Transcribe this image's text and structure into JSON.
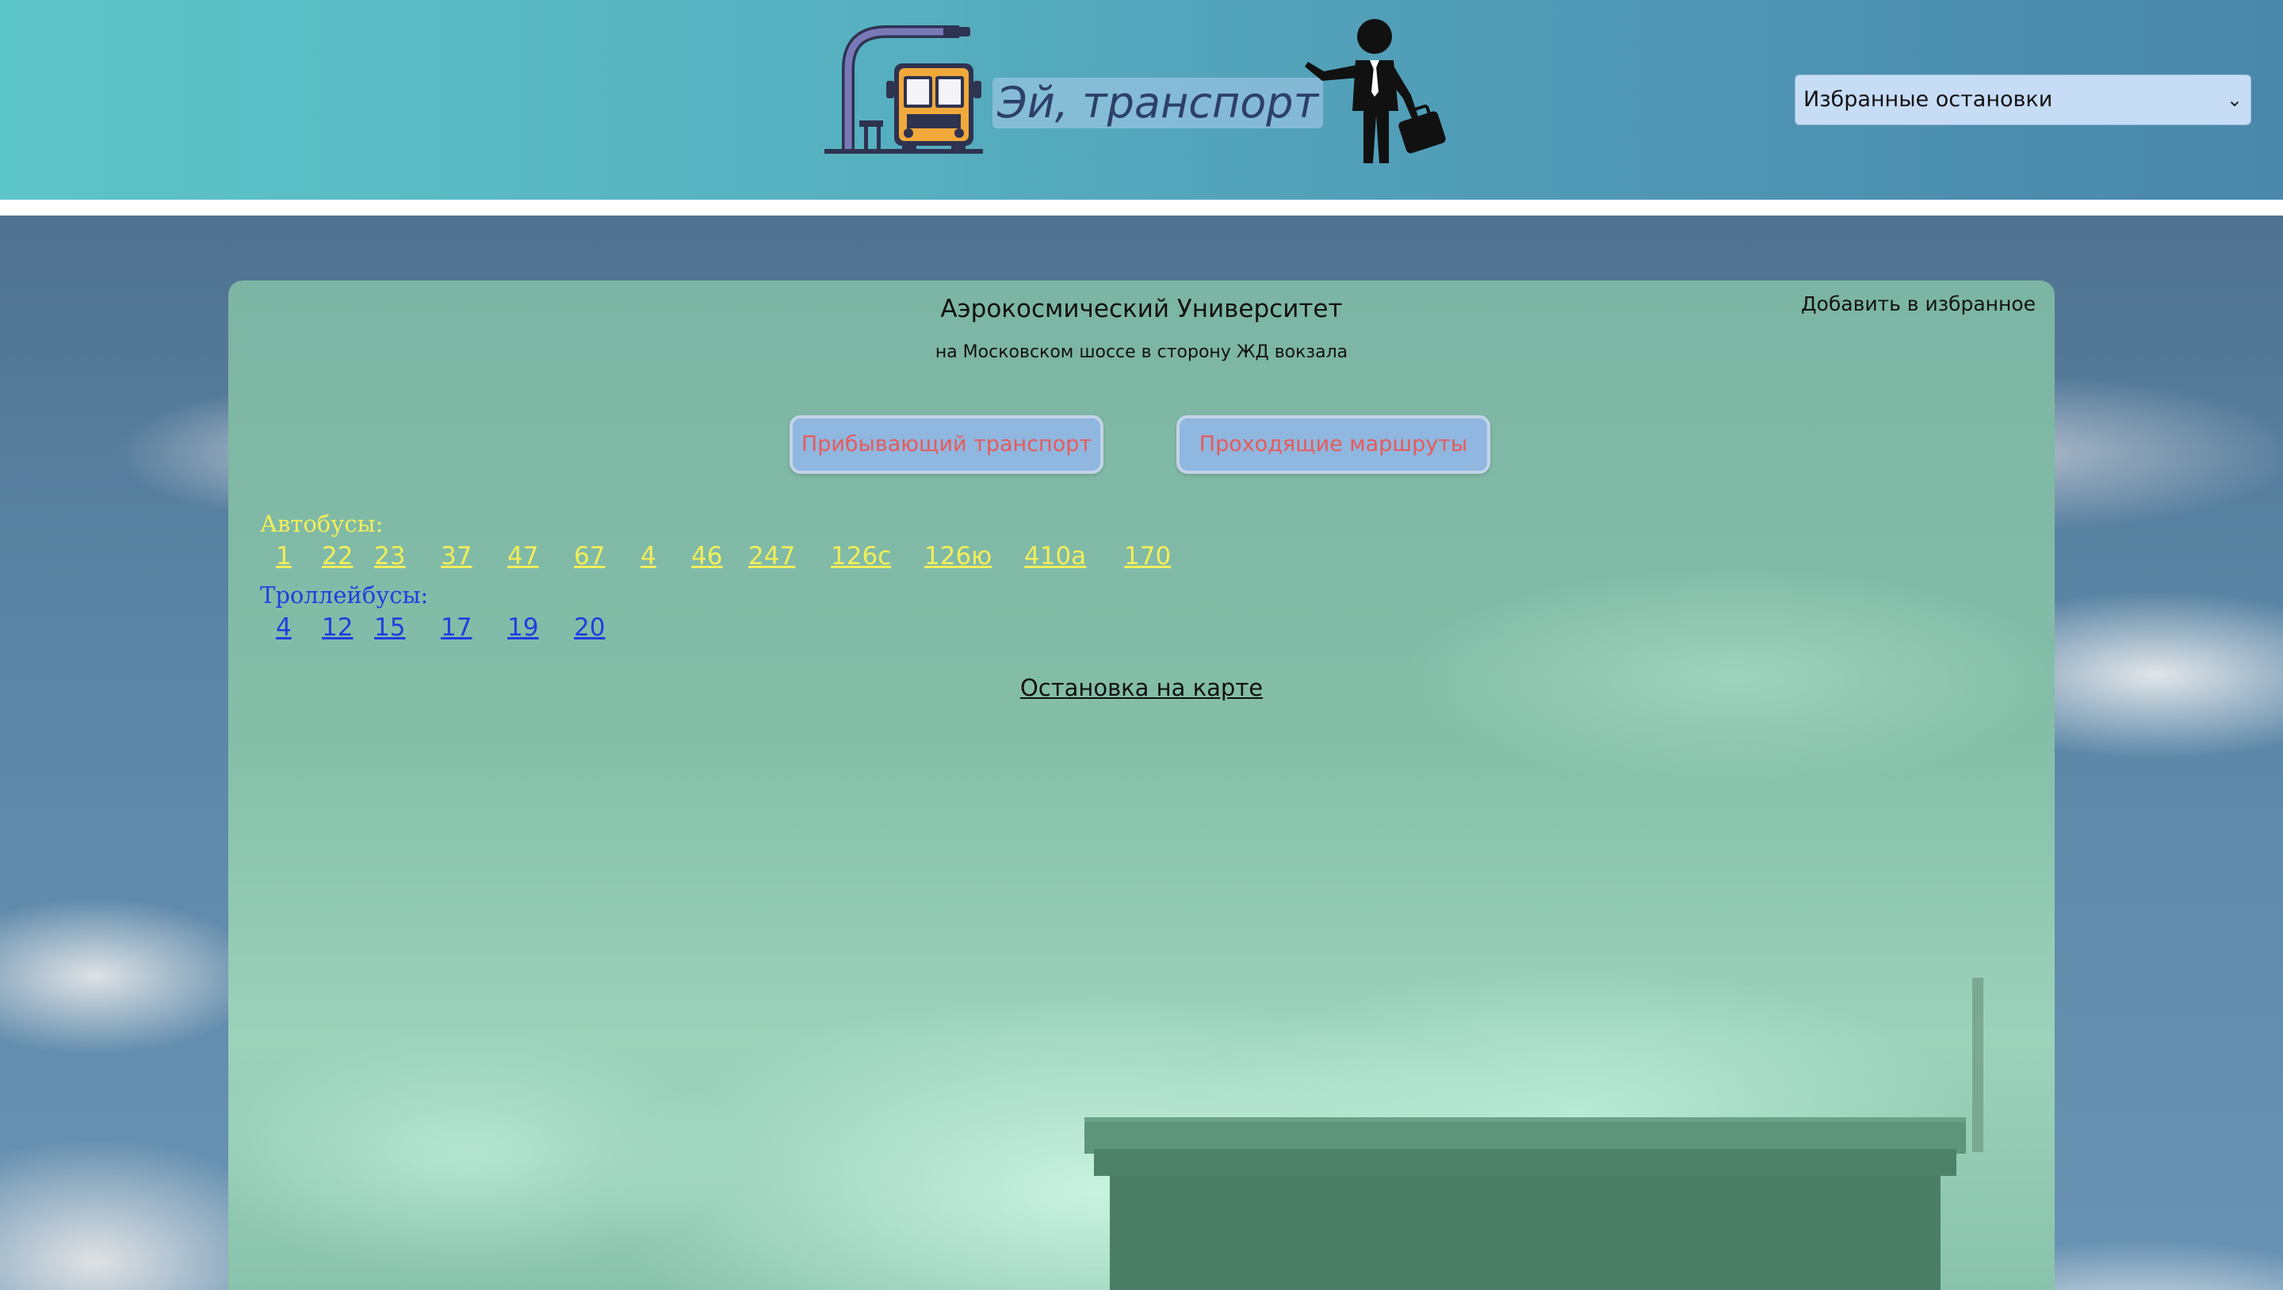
{
  "header": {
    "title": "Эй, транспорт",
    "favorites_select": {
      "value": "Избранные остановки",
      "chevron": "⌄"
    },
    "logo_icons": [
      "bus-stop-icon",
      "businessman-waving-icon"
    ]
  },
  "stop": {
    "name": "Аэрокосмический Университет",
    "direction": "на Московском шоссе в сторону ЖД вокзала",
    "add_favorite_label": "Добавить в избранное"
  },
  "tabs": [
    {
      "label": "Прибывающий транспорт"
    },
    {
      "label": "Проходящие маршруты"
    }
  ],
  "routes": {
    "bus": {
      "label": "Автобусы:",
      "color": "#f3ee5a",
      "numbers": [
        "1",
        "22",
        "23",
        "37",
        "47",
        "67",
        "4",
        "46",
        "247",
        "126с",
        "126ю",
        "410а",
        "170"
      ]
    },
    "trolleybus": {
      "label": "Троллейбусы:",
      "color": "#1e3fe0",
      "numbers": [
        "4",
        "12",
        "15",
        "17",
        "19",
        "20"
      ]
    }
  },
  "map_link_label": "Остановка на карте",
  "colors": {
    "tab_text": "#e85a5a",
    "tab_bg": "#8fb7e0",
    "header_title": "#2d4068"
  }
}
